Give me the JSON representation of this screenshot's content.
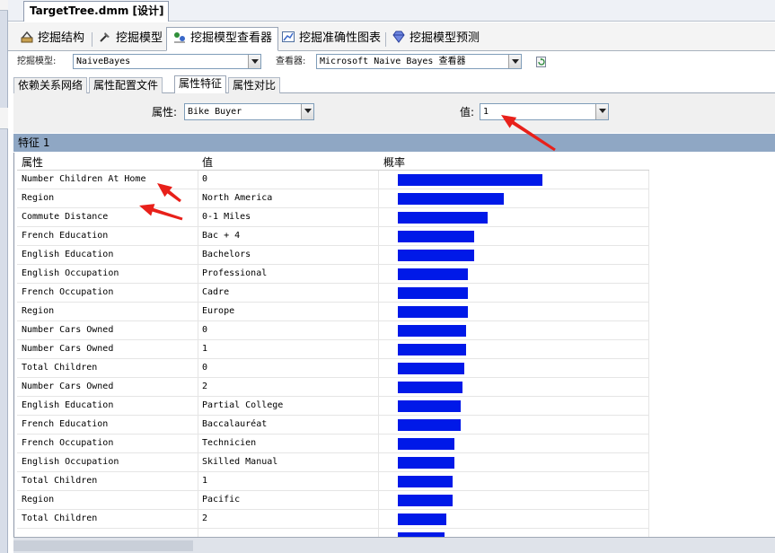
{
  "document": {
    "tab_title": "TargetTree.dmm [设计]"
  },
  "designer_tabs": [
    {
      "label": "挖掘结构",
      "icon": "mining-structure-icon"
    },
    {
      "label": "挖掘模型",
      "icon": "mining-model-icon"
    },
    {
      "label": "挖掘模型查看器",
      "icon": "model-viewer-icon",
      "active": true
    },
    {
      "label": "挖掘准确性图表",
      "icon": "accuracy-chart-icon"
    },
    {
      "label": "挖掘模型预测",
      "icon": "prediction-gem-icon"
    }
  ],
  "toolbar": {
    "model_label": "挖掘模型:",
    "model_value": "NaiveBayes",
    "viewer_label": "查看器:",
    "viewer_value": "Microsoft Naive Bayes 查看器",
    "refresh_icon": "refresh-icon"
  },
  "subtabs": [
    {
      "label": "依赖关系网络"
    },
    {
      "label": "属性配置文件"
    },
    {
      "label": "属性特征",
      "active": true
    },
    {
      "label": "属性对比"
    }
  ],
  "filter": {
    "attribute_label": "属性:",
    "attribute_value": "Bike Buyer",
    "value_label": "值:",
    "value_value": "1"
  },
  "band": {
    "title": "特征 1"
  },
  "table": {
    "headers": [
      "属性",
      "值",
      "概率"
    ],
    "rows": [
      {
        "attribute": "Number Children At Home",
        "value": "0",
        "probability": 0.87
      },
      {
        "attribute": "Region",
        "value": "North America",
        "probability": 0.64
      },
      {
        "attribute": "Commute Distance",
        "value": "0-1 Miles",
        "probability": 0.54
      },
      {
        "attribute": "French Education",
        "value": "Bac + 4",
        "probability": 0.46
      },
      {
        "attribute": "English Education",
        "value": "Bachelors",
        "probability": 0.46
      },
      {
        "attribute": "English Occupation",
        "value": "Professional",
        "probability": 0.42
      },
      {
        "attribute": "French Occupation",
        "value": "Cadre",
        "probability": 0.42
      },
      {
        "attribute": "Region",
        "value": "Europe",
        "probability": 0.42
      },
      {
        "attribute": "Number Cars Owned",
        "value": "0",
        "probability": 0.41
      },
      {
        "attribute": "Number Cars Owned",
        "value": "1",
        "probability": 0.41
      },
      {
        "attribute": "Total Children",
        "value": "0",
        "probability": 0.4
      },
      {
        "attribute": "Number Cars Owned",
        "value": "2",
        "probability": 0.39
      },
      {
        "attribute": "English Education",
        "value": "Partial College",
        "probability": 0.38
      },
      {
        "attribute": "French Education",
        "value": "Baccalauréat",
        "probability": 0.38
      },
      {
        "attribute": "French Occupation",
        "value": "Technicien",
        "probability": 0.34
      },
      {
        "attribute": "English Occupation",
        "value": "Skilled Manual",
        "probability": 0.34
      },
      {
        "attribute": "Total Children",
        "value": "1",
        "probability": 0.33
      },
      {
        "attribute": "Region",
        "value": "Pacific",
        "probability": 0.33
      },
      {
        "attribute": "Total Children",
        "value": "2",
        "probability": 0.29
      },
      {
        "attribute": "",
        "value": "",
        "probability": 0.28
      }
    ]
  },
  "colors": {
    "bar": "#0019e8",
    "band": "#8fa7c4",
    "annotation_arrow": "#e8201a"
  }
}
